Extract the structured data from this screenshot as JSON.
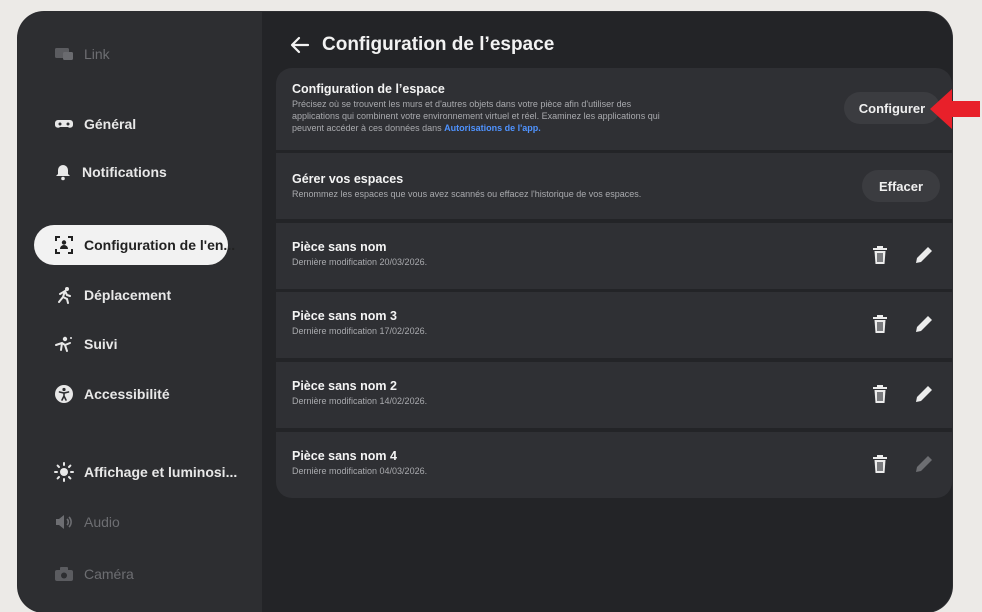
{
  "sidebar": {
    "items": [
      {
        "label": "Link",
        "icon": "link-icon",
        "state": "dim"
      },
      {
        "label": "Général",
        "icon": "gamepad-icon",
        "state": "normal"
      },
      {
        "label": "Notifications",
        "icon": "bell-icon",
        "state": "normal"
      },
      {
        "label": "Configuration de l'en...",
        "icon": "space-setup-icon",
        "state": "active"
      },
      {
        "label": "Déplacement",
        "icon": "movement-icon",
        "state": "normal"
      },
      {
        "label": "Suivi",
        "icon": "tracking-icon",
        "state": "normal"
      },
      {
        "label": "Accessibilité",
        "icon": "accessibility-icon",
        "state": "normal"
      },
      {
        "label": "Affichage et luminosi...",
        "icon": "brightness-icon",
        "state": "normal"
      },
      {
        "label": "Audio",
        "icon": "speaker-icon",
        "state": "dim"
      },
      {
        "label": "Caméra",
        "icon": "camera-icon",
        "state": "dim"
      }
    ]
  },
  "header": {
    "title": "Configuration de l’espace",
    "back_icon": "back-arrow-icon"
  },
  "space_setup": {
    "title": "Configuration de l’espace",
    "desc_line1": "Précisez où se trouvent les murs et d'autres objets dans votre pièce afin d'utiliser des",
    "desc_line2": "applications qui combinent votre environnement virtuel et réel. Examinez les applications qui",
    "desc_line3_prefix": "peuvent accéder à ces données dans ",
    "desc_link": "Autorisations de l'app.",
    "button_label": "Configurer"
  },
  "manage_spaces": {
    "title": "Gérer vos espaces",
    "desc": "Renommez les espaces que vous avez scannés ou effacez l'historique de vos espaces.",
    "button_label": "Effacer"
  },
  "rooms": [
    {
      "name": "Pièce sans nom",
      "modified": "Dernière modification 20/03/2026."
    },
    {
      "name": "Pièce sans nom 3",
      "modified": "Dernière modification 17/02/2026."
    },
    {
      "name": "Pièce sans nom 2",
      "modified": "Dernière modification 14/02/2026."
    },
    {
      "name": "Pièce sans nom 4",
      "modified": "Dernière modification 04/03/2026."
    }
  ],
  "colors": {
    "panel_bg": "#232427",
    "card_bg": "#2f3034",
    "link": "#4f93ff",
    "annotation_arrow": "#e8202a"
  },
  "annotation": {
    "icon": "red-arrow-icon"
  }
}
